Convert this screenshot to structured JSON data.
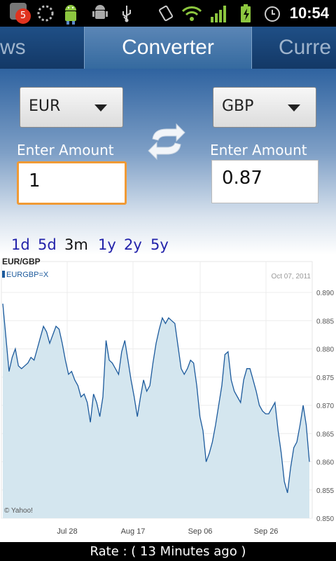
{
  "status_bar": {
    "notification_count": "5",
    "time": "10:54",
    "icons": [
      "notification-badge-icon",
      "loading-spinner-icon",
      "android-app-icon",
      "android-debug-icon",
      "usb-icon",
      "vibrate-icon",
      "wifi-icon",
      "signal-icon",
      "battery-charging-icon",
      "alarm-icon"
    ]
  },
  "tabs": {
    "left_partial": "ws",
    "active": "Converter",
    "right_partial": "Curre"
  },
  "converter": {
    "from_currency": "EUR",
    "to_currency": "GBP",
    "from_label": "Enter Amount",
    "to_label": "Enter Amount",
    "from_amount": "1",
    "to_amount": "0.87"
  },
  "ranges": [
    "1d",
    "5d",
    "3m",
    "1y",
    "2y",
    "5y"
  ],
  "active_range": "3m",
  "chart_data": {
    "type": "area",
    "title": "EUR/GBP",
    "legend": "EURGBP=X",
    "date_label": "Oct 07, 2011",
    "watermark": "© Yahoo!",
    "x_ticks": [
      "Jul 28",
      "Aug 17",
      "Sep 06",
      "Sep 26"
    ],
    "y_ticks": [
      "0.890",
      "0.885",
      "0.880",
      "0.875",
      "0.870",
      "0.865",
      "0.860",
      "0.855",
      "0.850"
    ],
    "ylim": [
      0.85,
      0.891
    ],
    "accent_color": "#1c5a9c",
    "fill_color": "#d4e6ef",
    "values": [
      0.888,
      0.882,
      0.876,
      0.8785,
      0.88,
      0.877,
      0.8765,
      0.877,
      0.8775,
      0.8785,
      0.878,
      0.88,
      0.882,
      0.884,
      0.883,
      0.881,
      0.8825,
      0.884,
      0.8835,
      0.881,
      0.878,
      0.8755,
      0.876,
      0.8745,
      0.8735,
      0.8715,
      0.872,
      0.8705,
      0.867,
      0.872,
      0.8705,
      0.868,
      0.8715,
      0.8815,
      0.878,
      0.8775,
      0.8765,
      0.8755,
      0.8795,
      0.8815,
      0.878,
      0.8745,
      0.8715,
      0.868,
      0.8715,
      0.8745,
      0.8725,
      0.8735,
      0.8775,
      0.881,
      0.8835,
      0.8855,
      0.8845,
      0.8855,
      0.885,
      0.8845,
      0.8805,
      0.8765,
      0.8755,
      0.8765,
      0.878,
      0.8775,
      0.8735,
      0.868,
      0.8655,
      0.86,
      0.8615,
      0.8635,
      0.8665,
      0.87,
      0.8735,
      0.879,
      0.8795,
      0.8745,
      0.8725,
      0.8715,
      0.8705,
      0.8745,
      0.8765,
      0.8765,
      0.8745,
      0.8725,
      0.87,
      0.869,
      0.8685,
      0.8685,
      0.8695,
      0.8705,
      0.8655,
      0.8615,
      0.8565,
      0.8545,
      0.859,
      0.8625,
      0.8635,
      0.8665,
      0.87,
      0.8665,
      0.86
    ]
  },
  "footer": {
    "rate_label": "Rate :  ( 13 Minutes ago )"
  }
}
